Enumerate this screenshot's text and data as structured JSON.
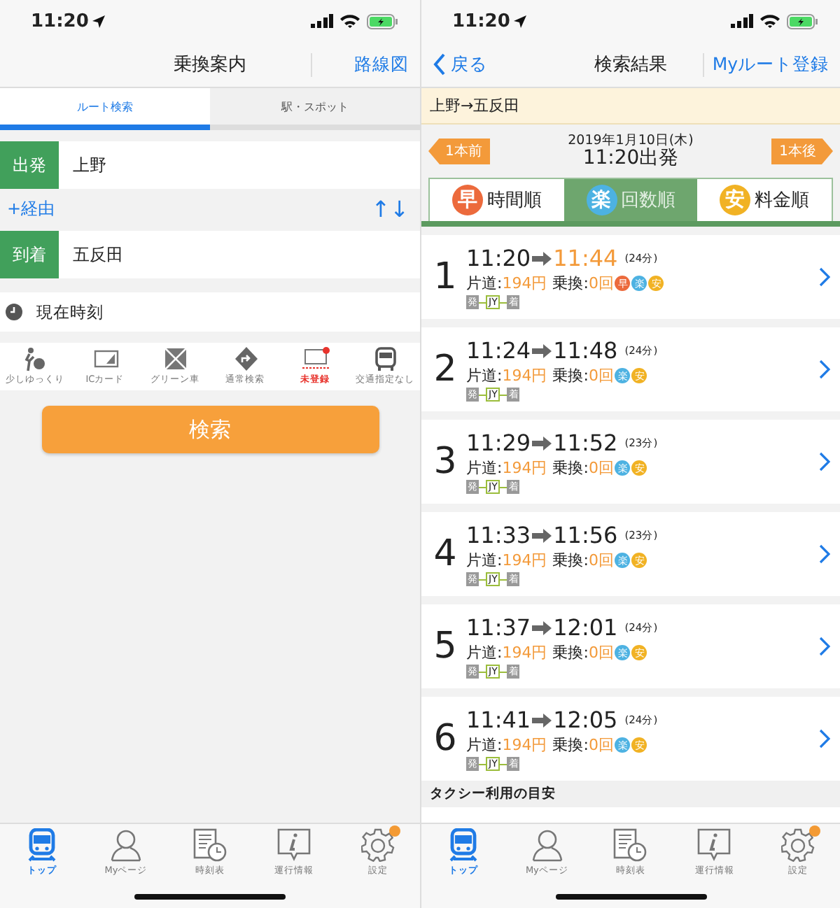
{
  "search_screen": {
    "status_bar": {
      "time": "11:20"
    },
    "nav": {
      "title": "乗換案内",
      "right_link": "路線図"
    },
    "tabs": [
      {
        "label": "ルート検索",
        "selected": true
      },
      {
        "label": "駅・スポット",
        "selected": false
      }
    ],
    "from": {
      "label": "出発",
      "value": "上野"
    },
    "via": {
      "label": "+経由",
      "swap": "↑↓"
    },
    "to": {
      "label": "到着",
      "value": "五反田"
    },
    "time": {
      "value": "現在時刻"
    },
    "options": [
      {
        "label": "少しゆっくり",
        "active": false
      },
      {
        "label": "ICカード",
        "active": false
      },
      {
        "label": "グリーン車",
        "active": false
      },
      {
        "label": "通常検索",
        "active": false
      },
      {
        "label": "未登録",
        "active": true
      },
      {
        "label": "交通指定なし",
        "active": false
      }
    ],
    "search_button": "検索",
    "tab_bar": [
      {
        "label": "トップ",
        "selected": true,
        "badge": false
      },
      {
        "label": "Myページ",
        "selected": false,
        "badge": false
      },
      {
        "label": "時刻表",
        "selected": false,
        "badge": false
      },
      {
        "label": "運行情報",
        "selected": false,
        "badge": false
      },
      {
        "label": "設定",
        "selected": false,
        "badge": true
      }
    ]
  },
  "results_screen": {
    "status_bar": {
      "time": "11:20"
    },
    "nav": {
      "back": "戻る",
      "title": "検索結果",
      "right_link": "Myルート登録"
    },
    "route": "上野→五反田",
    "date": "2019年1月10日(木)",
    "departure": "11:20出発",
    "prev_button": "1本前",
    "next_button": "1本後",
    "sort_tabs": [
      {
        "badge": "早",
        "color": "#ec6a3c",
        "label": "時間順",
        "selected": false
      },
      {
        "badge": "楽",
        "color": "#4db2e2",
        "label": "回数順",
        "selected": true
      },
      {
        "badge": "安",
        "color": "#f1b224",
        "label": "料金順",
        "selected": false
      }
    ],
    "results": [
      {
        "index": "1",
        "depart": "11:20",
        "arrive": "11:44",
        "duration": "(24分)",
        "fare_label": "片道:",
        "fare": "194円",
        "transfer_label": "乗換:",
        "transfers": "0回",
        "badges": [
          {
            "text": "早",
            "color": "#ec6a3c"
          },
          {
            "text": "楽",
            "color": "#4db2e2"
          },
          {
            "text": "安",
            "color": "#f1b224"
          }
        ],
        "path": [
          {
            "kind": "end",
            "text": "発"
          },
          {
            "kind": "line",
            "text": "JY"
          },
          {
            "kind": "end",
            "text": "着"
          }
        ],
        "highlight_arrival": true
      },
      {
        "index": "2",
        "depart": "11:24",
        "arrive": "11:48",
        "duration": "(24分)",
        "fare_label": "片道:",
        "fare": "194円",
        "transfer_label": "乗換:",
        "transfers": "0回",
        "badges": [
          {
            "text": "楽",
            "color": "#4db2e2"
          },
          {
            "text": "安",
            "color": "#f1b224"
          }
        ],
        "path": [
          {
            "kind": "end",
            "text": "発"
          },
          {
            "kind": "line",
            "text": "JY"
          },
          {
            "kind": "end",
            "text": "着"
          }
        ],
        "highlight_arrival": false
      },
      {
        "index": "3",
        "depart": "11:29",
        "arrive": "11:52",
        "duration": "(23分)",
        "fare_label": "片道:",
        "fare": "194円",
        "transfer_label": "乗換:",
        "transfers": "0回",
        "badges": [
          {
            "text": "楽",
            "color": "#4db2e2"
          },
          {
            "text": "安",
            "color": "#f1b224"
          }
        ],
        "path": [
          {
            "kind": "end",
            "text": "発"
          },
          {
            "kind": "line",
            "text": "JY"
          },
          {
            "kind": "end",
            "text": "着"
          }
        ],
        "highlight_arrival": false
      },
      {
        "index": "4",
        "depart": "11:33",
        "arrive": "11:56",
        "duration": "(23分)",
        "fare_label": "片道:",
        "fare": "194円",
        "transfer_label": "乗換:",
        "transfers": "0回",
        "badges": [
          {
            "text": "楽",
            "color": "#4db2e2"
          },
          {
            "text": "安",
            "color": "#f1b224"
          }
        ],
        "path": [
          {
            "kind": "end",
            "text": "発"
          },
          {
            "kind": "line",
            "text": "JY"
          },
          {
            "kind": "end",
            "text": "着"
          }
        ],
        "highlight_arrival": false
      },
      {
        "index": "5",
        "depart": "11:37",
        "arrive": "12:01",
        "duration": "(24分)",
        "fare_label": "片道:",
        "fare": "194円",
        "transfer_label": "乗換:",
        "transfers": "0回",
        "badges": [
          {
            "text": "楽",
            "color": "#4db2e2"
          },
          {
            "text": "安",
            "color": "#f1b224"
          }
        ],
        "path": [
          {
            "kind": "end",
            "text": "発"
          },
          {
            "kind": "line",
            "text": "JY"
          },
          {
            "kind": "end",
            "text": "着"
          }
        ],
        "highlight_arrival": false
      },
      {
        "index": "6",
        "depart": "11:41",
        "arrive": "12:05",
        "duration": "(24分)",
        "fare_label": "片道:",
        "fare": "194円",
        "transfer_label": "乗換:",
        "transfers": "0回",
        "badges": [
          {
            "text": "楽",
            "color": "#4db2e2"
          },
          {
            "text": "安",
            "color": "#f1b224"
          }
        ],
        "path": [
          {
            "kind": "end",
            "text": "発"
          },
          {
            "kind": "line",
            "text": "JY"
          },
          {
            "kind": "end",
            "text": "着"
          }
        ],
        "highlight_arrival": false
      }
    ],
    "taxi_header": "タクシー利用の目安",
    "tab_bar": [
      {
        "label": "トップ",
        "selected": true,
        "badge": false
      },
      {
        "label": "Myページ",
        "selected": false,
        "badge": false
      },
      {
        "label": "時刻表",
        "selected": false,
        "badge": false
      },
      {
        "label": "運行情報",
        "selected": false,
        "badge": false
      },
      {
        "label": "設定",
        "selected": false,
        "badge": true
      }
    ]
  }
}
